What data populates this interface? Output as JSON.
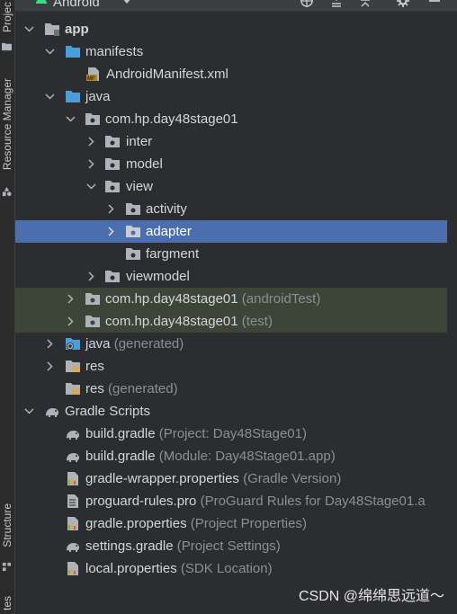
{
  "sidebar": {
    "project_tab": "Projec",
    "resource_manager_tab": "Resource Manager",
    "structure_tab": "Structure",
    "bottom_tab": "tes"
  },
  "header": {
    "title": "Android",
    "android-icon": "android-icon",
    "buttons": [
      "target-icon",
      "collapse-all-icon",
      "expand-all-icon",
      "gear-icon",
      "minimize-icon"
    ]
  },
  "tree": {
    "app": "app",
    "manifests": "manifests",
    "android_manifest": "AndroidManifest.xml",
    "java": "java",
    "pkg_main": "com.hp.day48stage01",
    "inter": "inter",
    "model": "model",
    "view": "view",
    "activity": "activity",
    "adapter": "adapter",
    "fargment": "fargment",
    "viewmodel": "viewmodel",
    "pkg_android_test": "com.hp.day48stage01",
    "pkg_android_test_hint": "(androidTest)",
    "pkg_test": "com.hp.day48stage01",
    "pkg_test_hint": "(test)",
    "java_generated": "java",
    "java_generated_hint": "(generated)",
    "res": "res",
    "res_generated": "res",
    "res_generated_hint": "(generated)",
    "gradle_scripts": "Gradle Scripts",
    "build_gradle_project": "build.gradle",
    "build_gradle_project_hint": "(Project: Day48Stage01)",
    "build_gradle_module": "build.gradle",
    "build_gradle_module_hint": "(Module: Day48Stage01.app)",
    "gradle_wrapper": "gradle-wrapper.properties",
    "gradle_wrapper_hint": "(Gradle Version)",
    "proguard": "proguard-rules.pro",
    "proguard_hint": "(ProGuard Rules for Day48Stage01.a",
    "gradle_properties": "gradle.properties",
    "gradle_properties_hint": "(Project Properties)",
    "settings_gradle": "settings.gradle",
    "settings_gradle_hint": "(Project Settings)",
    "local_properties": "local.properties",
    "local_properties_hint": "(SDK Location)"
  },
  "watermark": "CSDN @绵绵思远道～",
  "colors": {
    "background": "#2b2d30",
    "selection": "#4b6eaf",
    "test_highlight": "#3d4438",
    "folder": "#aeb3b9",
    "java_folder": "#4a9eda",
    "hint_text": "#8c8f93"
  }
}
